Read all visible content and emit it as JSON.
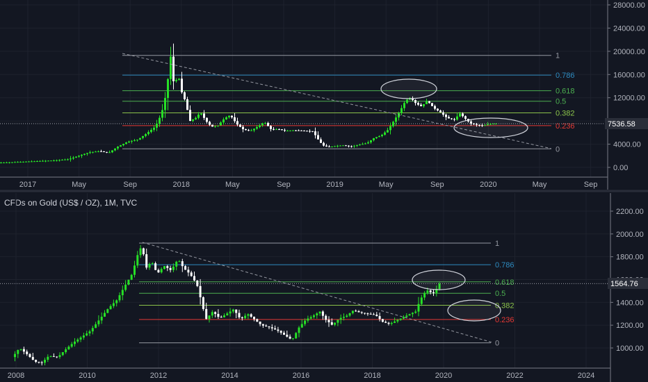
{
  "chart_data": [
    {
      "type": "candlestick",
      "instrument_label": "",
      "last_price": "7536.58",
      "y_ticks": [
        "28000.00",
        "24000.00",
        "20000.00",
        "16000.00",
        "12000.00",
        "8000.00",
        "4000.00",
        "0.00"
      ],
      "y_tick_values": [
        28000,
        24000,
        20000,
        16000,
        12000,
        8000,
        4000,
        0
      ],
      "ylim": [
        -800,
        29000
      ],
      "x_ticks": [
        "2017",
        "May",
        "Sep",
        "2018",
        "May",
        "Sep",
        "2019",
        "May",
        "Sep",
        "2020",
        "May",
        "Sep"
      ],
      "fib_levels": [
        {
          "label": "1",
          "value": 19300,
          "color": "#9598a1"
        },
        {
          "label": "0.786",
          "value": 15900,
          "color": "#2e8bc0"
        },
        {
          "label": "0.618",
          "value": 13200,
          "color": "#4caf50"
        },
        {
          "label": "0.5",
          "value": 11400,
          "color": "#4caf50"
        },
        {
          "label": "0.382",
          "value": 9400,
          "color": "#8bc34a"
        },
        {
          "label": "0.236",
          "value": 7200,
          "color": "#e53935"
        },
        {
          "label": "0",
          "value": 3200,
          "color": "#9598a1"
        }
      ],
      "price_path": [
        [
          0,
          800
        ],
        [
          20,
          900
        ],
        [
          40,
          1000
        ],
        [
          60,
          1100
        ],
        [
          80,
          1200
        ],
        [
          100,
          1400
        ],
        [
          115,
          2000
        ],
        [
          130,
          2600
        ],
        [
          145,
          2800
        ],
        [
          158,
          2500
        ],
        [
          170,
          3500
        ],
        [
          185,
          4400
        ],
        [
          200,
          4800
        ],
        [
          212,
          5800
        ],
        [
          225,
          7000
        ],
        [
          233,
          9000
        ],
        [
          238,
          11000
        ],
        [
          243,
          15000
        ],
        [
          247,
          19300
        ],
        [
          252,
          14000
        ],
        [
          258,
          16000
        ],
        [
          263,
          13000
        ],
        [
          268,
          11500
        ],
        [
          275,
          8000
        ],
        [
          283,
          8500
        ],
        [
          290,
          9500
        ],
        [
          298,
          8000
        ],
        [
          306,
          7000
        ],
        [
          315,
          7200
        ],
        [
          325,
          8500
        ],
        [
          333,
          9000
        ],
        [
          342,
          7500
        ],
        [
          352,
          6500
        ],
        [
          362,
          6300
        ],
        [
          372,
          7000
        ],
        [
          382,
          7800
        ],
        [
          392,
          6500
        ],
        [
          402,
          6600
        ],
        [
          412,
          6300
        ],
        [
          425,
          6400
        ],
        [
          440,
          6300
        ],
        [
          452,
          6200
        ],
        [
          458,
          5000
        ],
        [
          466,
          3800
        ],
        [
          474,
          3500
        ],
        [
          484,
          3700
        ],
        [
          496,
          3800
        ],
        [
          506,
          3600
        ],
        [
          518,
          3900
        ],
        [
          530,
          4200
        ],
        [
          540,
          5100
        ],
        [
          550,
          5500
        ],
        [
          560,
          6500
        ],
        [
          568,
          8000
        ],
        [
          576,
          9500
        ],
        [
          585,
          11500
        ],
        [
          592,
          12000
        ],
        [
          600,
          11000
        ],
        [
          608,
          10500
        ],
        [
          616,
          11500
        ],
        [
          626,
          10200
        ],
        [
          635,
          9500
        ],
        [
          645,
          8500
        ],
        [
          655,
          8200
        ],
        [
          663,
          9300
        ],
        [
          670,
          8500
        ],
        [
          678,
          7600
        ],
        [
          688,
          7300
        ],
        [
          697,
          7200
        ],
        [
          706,
          7500
        ],
        [
          712,
          7536
        ]
      ]
    },
    {
      "type": "candlestick",
      "title": "CFDs on Gold (US$ / OZ), 1M, TVC",
      "last_price": "1564.76",
      "y_ticks": [
        "2200.00",
        "2000.00",
        "1800.00",
        "1600.00",
        "1400.00",
        "1200.00",
        "1000.00"
      ],
      "y_tick_values": [
        2200,
        2000,
        1800,
        1600,
        1400,
        1200,
        1000
      ],
      "ylim": [
        900,
        2250
      ],
      "x_ticks": [
        "2008",
        "2010",
        "2012",
        "2014",
        "2016",
        "2018",
        "2020",
        "2022",
        "2024"
      ],
      "fib_levels": [
        {
          "label": "1",
          "value": 1920,
          "color": "#9598a1"
        },
        {
          "label": "0.786",
          "value": 1730,
          "color": "#2e8bc0"
        },
        {
          "label": "0.618",
          "value": 1580,
          "color": "#4caf50"
        },
        {
          "label": "0.5",
          "value": 1480,
          "color": "#4caf50"
        },
        {
          "label": "0.382",
          "value": 1375,
          "color": "#8bc34a"
        },
        {
          "label": "0.236",
          "value": 1250,
          "color": "#e53935"
        },
        {
          "label": "0",
          "value": 1045,
          "color": "#9598a1"
        }
      ],
      "price_path": [
        [
          20,
          920
        ],
        [
          30,
          1000
        ],
        [
          40,
          950
        ],
        [
          52,
          880
        ],
        [
          62,
          870
        ],
        [
          72,
          930
        ],
        [
          85,
          920
        ],
        [
          95,
          980
        ],
        [
          108,
          1050
        ],
        [
          120,
          1100
        ],
        [
          132,
          1150
        ],
        [
          145,
          1250
        ],
        [
          158,
          1350
        ],
        [
          170,
          1420
        ],
        [
          182,
          1550
        ],
        [
          192,
          1650
        ],
        [
          200,
          1820
        ],
        [
          206,
          1900
        ],
        [
          212,
          1700
        ],
        [
          220,
          1760
        ],
        [
          228,
          1650
        ],
        [
          238,
          1720
        ],
        [
          248,
          1680
        ],
        [
          258,
          1780
        ],
        [
          266,
          1700
        ],
        [
          275,
          1650
        ],
        [
          285,
          1560
        ],
        [
          292,
          1400
        ],
        [
          298,
          1250
        ],
        [
          308,
          1320
        ],
        [
          318,
          1260
        ],
        [
          328,
          1300
        ],
        [
          338,
          1340
        ],
        [
          348,
          1250
        ],
        [
          358,
          1300
        ],
        [
          368,
          1250
        ],
        [
          378,
          1200
        ],
        [
          390,
          1180
        ],
        [
          402,
          1150
        ],
        [
          412,
          1110
        ],
        [
          422,
          1070
        ],
        [
          432,
          1180
        ],
        [
          442,
          1250
        ],
        [
          452,
          1280
        ],
        [
          462,
          1320
        ],
        [
          470,
          1250
        ],
        [
          480,
          1200
        ],
        [
          490,
          1260
        ],
        [
          500,
          1280
        ],
        [
          510,
          1330
        ],
        [
          520,
          1310
        ],
        [
          530,
          1300
        ],
        [
          542,
          1290
        ],
        [
          552,
          1230
        ],
        [
          562,
          1210
        ],
        [
          572,
          1240
        ],
        [
          582,
          1270
        ],
        [
          592,
          1300
        ],
        [
          600,
          1320
        ],
        [
          606,
          1420
        ],
        [
          612,
          1480
        ],
        [
          618,
          1510
        ],
        [
          624,
          1470
        ],
        [
          630,
          1520
        ],
        [
          634,
          1564
        ]
      ]
    }
  ]
}
